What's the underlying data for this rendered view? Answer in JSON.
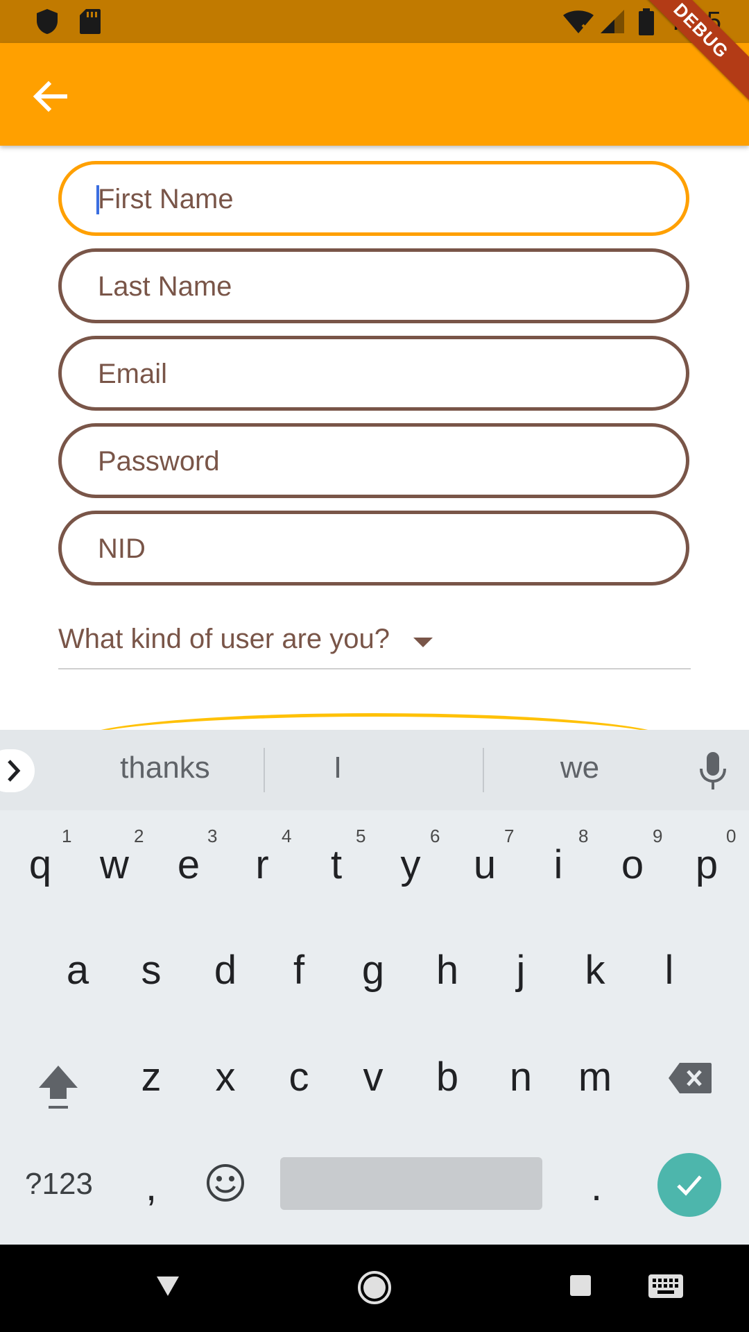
{
  "status_bar": {
    "time": "7:15",
    "icons": [
      "shield-icon",
      "sd-card-icon",
      "wifi-off-icon",
      "signal-icon",
      "battery-icon"
    ]
  },
  "app_bar": {
    "back_icon": "arrow-back-icon",
    "color": "#ffa000",
    "debug_label": "DEBUG"
  },
  "form": {
    "fields": [
      {
        "name": "first-name",
        "placeholder": "First Name",
        "value": "",
        "focused": true
      },
      {
        "name": "last-name",
        "placeholder": "Last Name",
        "value": "",
        "focused": false
      },
      {
        "name": "email",
        "placeholder": "Email",
        "value": "",
        "focused": false
      },
      {
        "name": "password",
        "placeholder": "Password",
        "value": "",
        "focused": false
      },
      {
        "name": "nid",
        "placeholder": "NID",
        "value": "",
        "focused": false
      }
    ],
    "user_type_dropdown": {
      "label": "What kind of user are you?"
    },
    "accent_color": "#ffa000",
    "outline_color": "#795548"
  },
  "keyboard": {
    "suggestions": [
      "thanks",
      "I",
      "we"
    ],
    "row1": [
      "q",
      "w",
      "e",
      "r",
      "t",
      "y",
      "u",
      "i",
      "o",
      "p"
    ],
    "row1_hints": [
      "1",
      "2",
      "3",
      "4",
      "5",
      "6",
      "7",
      "8",
      "9",
      "0"
    ],
    "row2": [
      "a",
      "s",
      "d",
      "f",
      "g",
      "h",
      "j",
      "k",
      "l"
    ],
    "row3": [
      "z",
      "x",
      "c",
      "v",
      "b",
      "n",
      "m"
    ],
    "symbols_key": "?123",
    "comma_key": ",",
    "period_key": ".",
    "enter_color": "#4db6ac"
  },
  "nav_bar": {
    "icons": [
      "back-triangle-icon",
      "home-circle-icon",
      "recents-square-icon",
      "keyboard-switch-icon"
    ]
  }
}
